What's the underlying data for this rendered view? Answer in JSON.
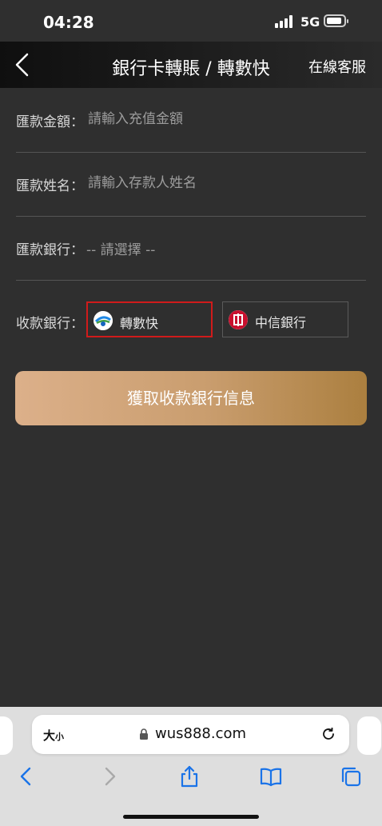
{
  "status": {
    "time": "04:28",
    "network": "5G"
  },
  "nav": {
    "title": "銀行卡轉賬 / 轉數快",
    "service": "在線客服"
  },
  "form": {
    "amount": {
      "label": "匯款金額：",
      "placeholder": "請輸入充值金額"
    },
    "name": {
      "label": "匯款姓名：",
      "placeholder": "請輸入存款人姓名"
    },
    "bank": {
      "label": "匯款銀行：",
      "value": "-- 請選擇 --"
    },
    "receive": {
      "label": "收款銀行：",
      "options": [
        {
          "name": "轉數快",
          "icon": "fps-icon",
          "selected": true
        },
        {
          "name": "中信銀行",
          "icon": "citic-bank-icon",
          "selected": false
        }
      ]
    }
  },
  "submit": {
    "label": "獲取收款銀行信息"
  },
  "browser": {
    "text_size_big": "大",
    "text_size_small": "小",
    "url": "wus888.com"
  },
  "colors": {
    "background": "#2f2f2f",
    "button_start": "#dcb08a",
    "button_end": "#ab7f3f",
    "selected_border": "#d01b1b",
    "ios_blue": "#1a73e8"
  }
}
